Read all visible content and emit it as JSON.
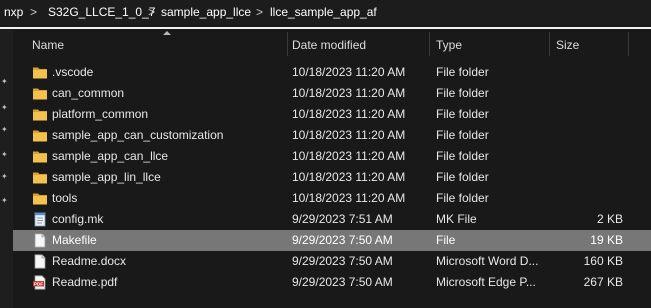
{
  "breadcrumb": {
    "items": [
      "nxp",
      "S32G_LLCE_1_0_7",
      "sample_app_llce",
      "llce_sample_app_af"
    ],
    "separator": ">"
  },
  "columns": {
    "name": "Name",
    "date_modified": "Date modified",
    "type": "Type",
    "size": "Size"
  },
  "files": [
    {
      "name": ".vscode",
      "date": "10/18/2023 11:20 AM",
      "type": "File folder",
      "size": "",
      "icon": "folder-icon"
    },
    {
      "name": "can_common",
      "date": "10/18/2023 11:20 AM",
      "type": "File folder",
      "size": "",
      "icon": "folder-icon"
    },
    {
      "name": "platform_common",
      "date": "10/18/2023 11:20 AM",
      "type": "File folder",
      "size": "",
      "icon": "folder-icon"
    },
    {
      "name": "sample_app_can_customization",
      "date": "10/18/2023 11:20 AM",
      "type": "File folder",
      "size": "",
      "icon": "folder-icon"
    },
    {
      "name": "sample_app_can_llce",
      "date": "10/18/2023 11:20 AM",
      "type": "File folder",
      "size": "",
      "icon": "folder-icon"
    },
    {
      "name": "sample_app_lin_llce",
      "date": "10/18/2023 11:20 AM",
      "type": "File folder",
      "size": "",
      "icon": "folder-icon"
    },
    {
      "name": "tools",
      "date": "10/18/2023 11:20 AM",
      "type": "File folder",
      "size": "",
      "icon": "folder-icon"
    },
    {
      "name": "config.mk",
      "date": "9/29/2023 7:51 AM",
      "type": "MK File",
      "size": "2 KB",
      "icon": "notepad-file-icon"
    },
    {
      "name": "Makefile",
      "date": "9/29/2023 7:50 AM",
      "type": "File",
      "size": "19 KB",
      "icon": "blank-file-icon",
      "selected": true
    },
    {
      "name": "Readme.docx",
      "date": "9/29/2023 7:50 AM",
      "type": "Microsoft Word D...",
      "size": "160 KB",
      "icon": "blank-file-icon"
    },
    {
      "name": "Readme.pdf",
      "date": "9/29/2023 7:50 AM",
      "type": "Microsoft Edge P...",
      "size": "267 KB",
      "icon": "pdf-file-icon"
    }
  ],
  "colors": {
    "background": "#191919",
    "selection": "#777777",
    "folder": "#e8b33d",
    "pdf": "#c0392b"
  }
}
